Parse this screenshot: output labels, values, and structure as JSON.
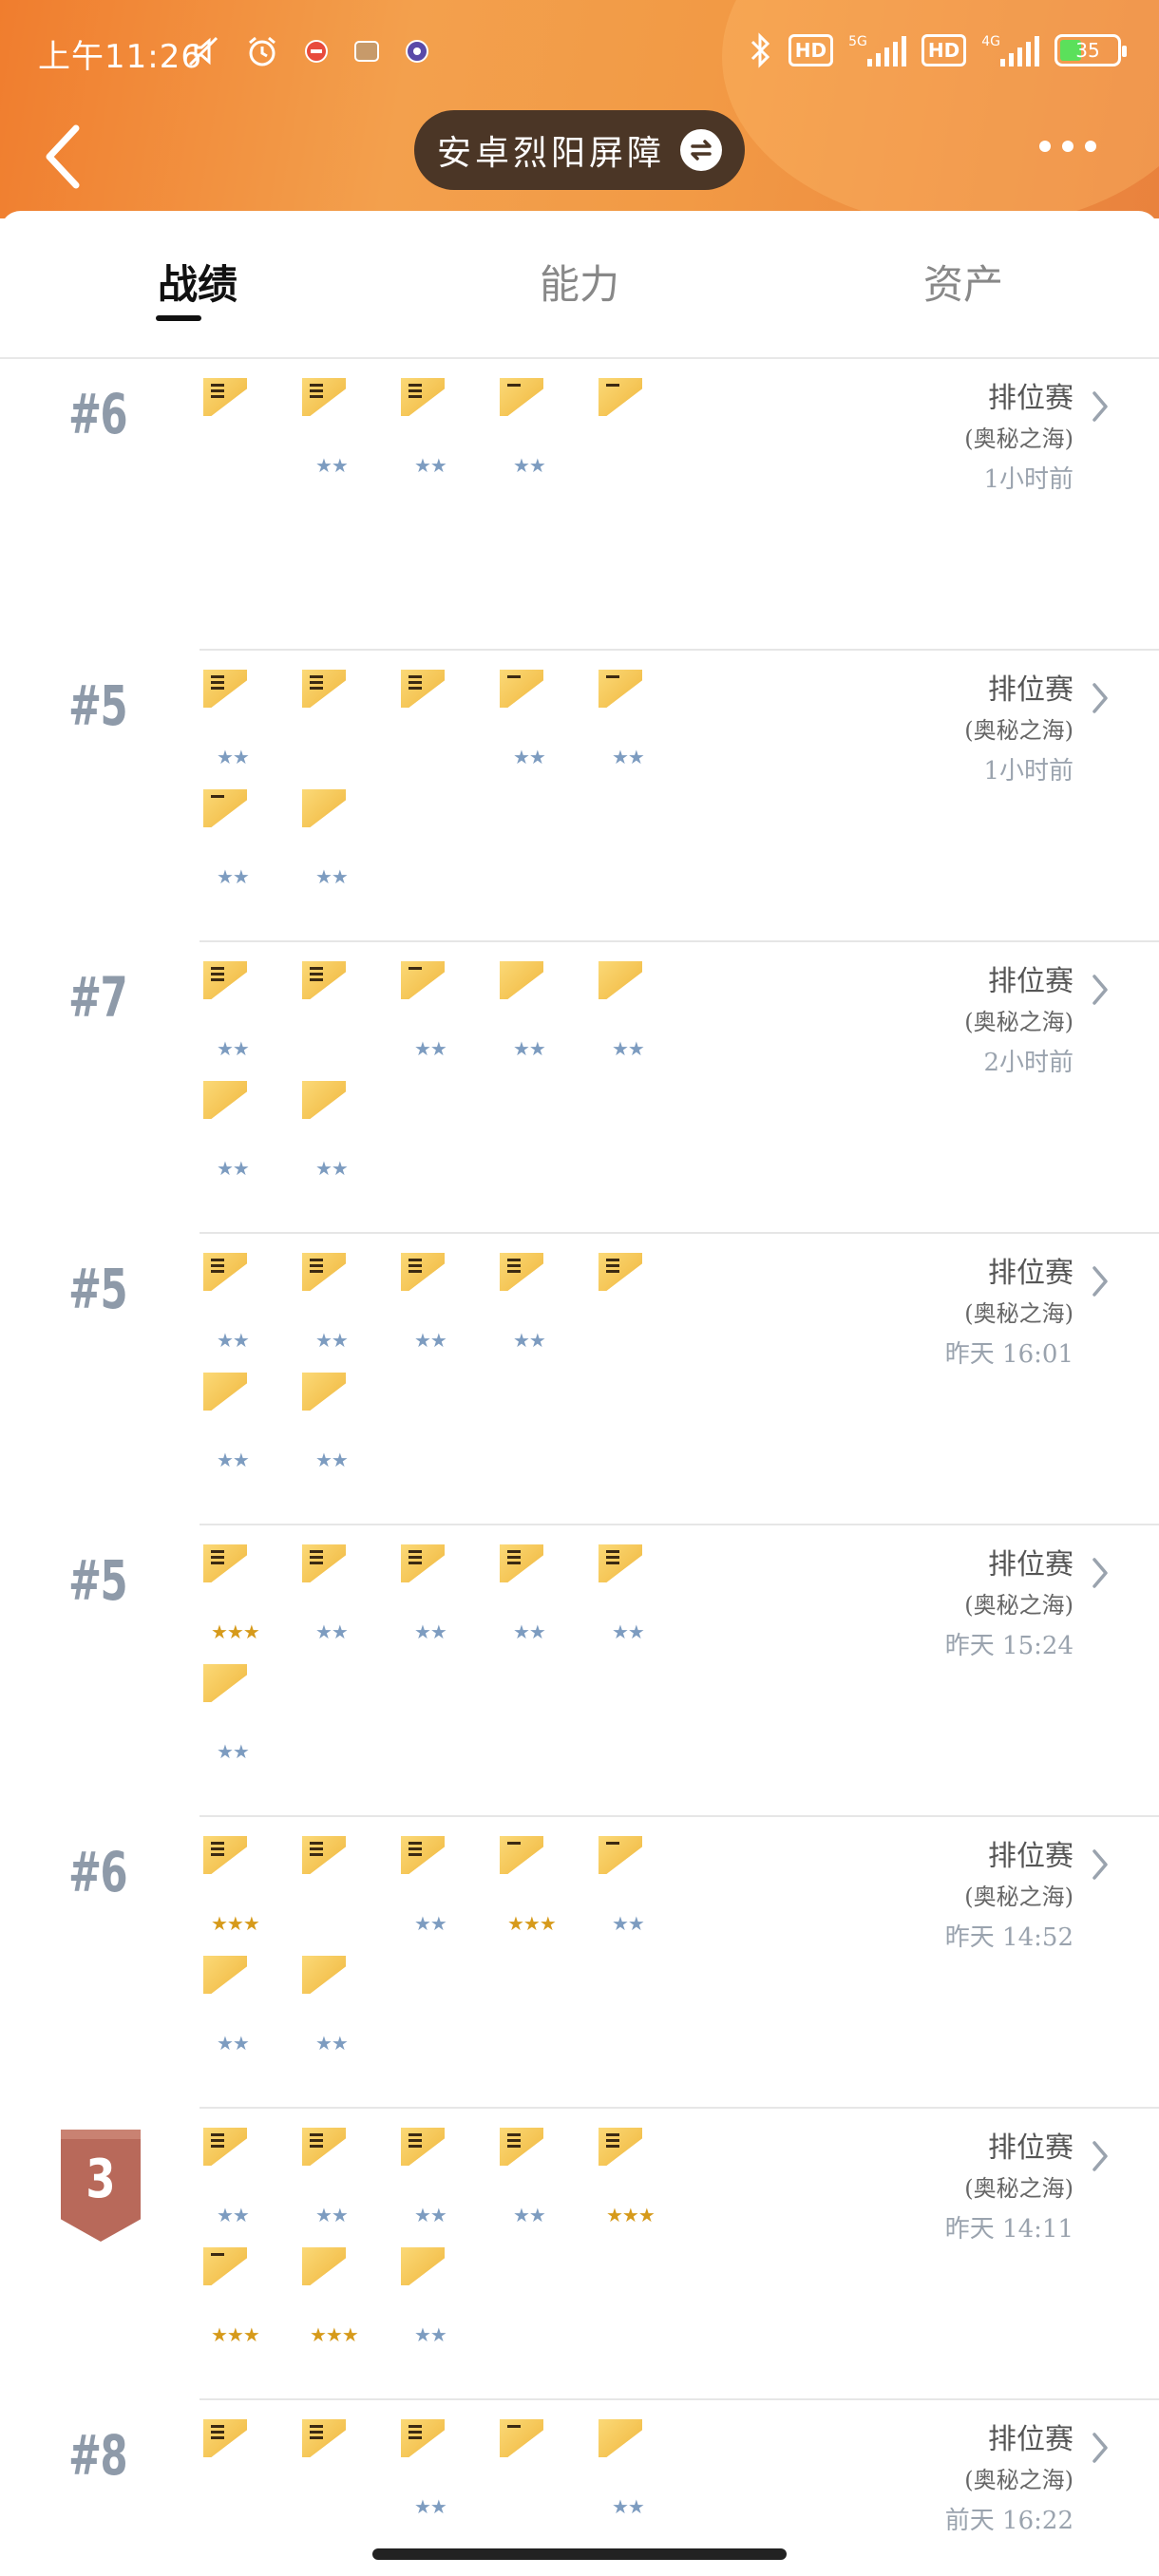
{
  "status_bar": {
    "time": "上午11:26",
    "left_icons": [
      "mute-icon",
      "alarm-icon",
      "app-notification-icon",
      "app-notification-icon",
      "app-notification-icon"
    ],
    "right_icons": [
      "bluetooth-icon",
      "hd-badge",
      "signal-5g-icon",
      "hd-badge",
      "signal-4g-icon"
    ],
    "hd_label": "HD",
    "net_5g": "5G",
    "net_4g": "4G",
    "battery": "35"
  },
  "nav": {
    "title": "安卓烈阳屏障",
    "back_icon": "chevron-left-icon",
    "switch_icon": "swap-icon",
    "more_icon": "more-dots-icon"
  },
  "tabs": [
    {
      "label": "战绩",
      "active": true
    },
    {
      "label": "能力",
      "active": false
    },
    {
      "label": "资产",
      "active": false
    }
  ],
  "colors": {
    "header_orange": "#f29a45",
    "pill_brown": "#4b3626",
    "card_yellow": "#f8c95a",
    "star_blue": "#7d9cc0",
    "star_gold": "#d69a1b",
    "medal_bronze": "#b8695a",
    "rank_gray": "#8e9aa9"
  },
  "matches": [
    {
      "rank": "#6",
      "medal": false,
      "mode": "排位赛",
      "mode_sub": "(奥秘之海)",
      "time": "1小时前",
      "heroes": [
        {
          "lines": 3,
          "stars": 0,
          "star_color": "blue"
        },
        {
          "lines": 3,
          "stars": 2,
          "star_color": "blue"
        },
        {
          "lines": 3,
          "stars": 2,
          "star_color": "blue"
        },
        {
          "lines": 1,
          "stars": 2,
          "star_color": "blue"
        },
        {
          "lines": 1,
          "stars": 0,
          "star_color": "blue"
        }
      ]
    },
    {
      "rank": "#5",
      "medal": false,
      "mode": "排位赛",
      "mode_sub": "(奥秘之海)",
      "time": "1小时前",
      "heroes": [
        {
          "lines": 3,
          "stars": 2,
          "star_color": "blue"
        },
        {
          "lines": 3,
          "stars": 0,
          "star_color": "blue"
        },
        {
          "lines": 3,
          "stars": 0,
          "star_color": "blue"
        },
        {
          "lines": 1,
          "stars": 2,
          "star_color": "blue"
        },
        {
          "lines": 1,
          "stars": 2,
          "star_color": "blue"
        },
        {
          "lines": 1,
          "stars": 2,
          "star_color": "blue"
        },
        {
          "lines": 0,
          "stars": 2,
          "star_color": "blue"
        }
      ]
    },
    {
      "rank": "#7",
      "medal": false,
      "mode": "排位赛",
      "mode_sub": "(奥秘之海)",
      "time": "2小时前",
      "heroes": [
        {
          "lines": 3,
          "stars": 2,
          "star_color": "blue"
        },
        {
          "lines": 3,
          "stars": 0,
          "star_color": "blue"
        },
        {
          "lines": 1,
          "stars": 2,
          "star_color": "blue"
        },
        {
          "lines": 0,
          "stars": 2,
          "star_color": "blue"
        },
        {
          "lines": 0,
          "stars": 2,
          "star_color": "blue"
        },
        {
          "lines": 0,
          "stars": 2,
          "star_color": "blue"
        },
        {
          "lines": 0,
          "stars": 2,
          "star_color": "blue"
        }
      ]
    },
    {
      "rank": "#5",
      "medal": false,
      "mode": "排位赛",
      "mode_sub": "(奥秘之海)",
      "time": "昨天 16:01",
      "heroes": [
        {
          "lines": 3,
          "stars": 2,
          "star_color": "blue"
        },
        {
          "lines": 3,
          "stars": 2,
          "star_color": "blue"
        },
        {
          "lines": 3,
          "stars": 2,
          "star_color": "blue"
        },
        {
          "lines": 3,
          "stars": 2,
          "star_color": "blue"
        },
        {
          "lines": 3,
          "stars": 0,
          "star_color": "blue"
        },
        {
          "lines": 0,
          "stars": 2,
          "star_color": "blue"
        },
        {
          "lines": 0,
          "stars": 2,
          "star_color": "blue"
        }
      ]
    },
    {
      "rank": "#5",
      "medal": false,
      "mode": "排位赛",
      "mode_sub": "(奥秘之海)",
      "time": "昨天 15:24",
      "heroes": [
        {
          "lines": 3,
          "stars": 3,
          "star_color": "gold"
        },
        {
          "lines": 3,
          "stars": 2,
          "star_color": "blue"
        },
        {
          "lines": 3,
          "stars": 2,
          "star_color": "blue"
        },
        {
          "lines": 3,
          "stars": 2,
          "star_color": "blue"
        },
        {
          "lines": 3,
          "stars": 2,
          "star_color": "blue"
        },
        {
          "lines": 0,
          "stars": 2,
          "star_color": "blue"
        }
      ]
    },
    {
      "rank": "#6",
      "medal": false,
      "mode": "排位赛",
      "mode_sub": "(奥秘之海)",
      "time": "昨天 14:52",
      "heroes": [
        {
          "lines": 3,
          "stars": 3,
          "star_color": "gold"
        },
        {
          "lines": 3,
          "stars": 0,
          "star_color": "blue"
        },
        {
          "lines": 3,
          "stars": 2,
          "star_color": "blue"
        },
        {
          "lines": 1,
          "stars": 3,
          "star_color": "gold"
        },
        {
          "lines": 1,
          "stars": 2,
          "star_color": "blue"
        },
        {
          "lines": 0,
          "stars": 2,
          "star_color": "blue"
        },
        {
          "lines": 0,
          "stars": 2,
          "star_color": "blue"
        }
      ]
    },
    {
      "rank": "3",
      "medal": true,
      "mode": "排位赛",
      "mode_sub": "(奥秘之海)",
      "time": "昨天 14:11",
      "heroes": [
        {
          "lines": 3,
          "stars": 2,
          "star_color": "blue"
        },
        {
          "lines": 3,
          "stars": 2,
          "star_color": "blue"
        },
        {
          "lines": 3,
          "stars": 2,
          "star_color": "blue"
        },
        {
          "lines": 3,
          "stars": 2,
          "star_color": "blue"
        },
        {
          "lines": 3,
          "stars": 3,
          "star_color": "gold"
        },
        {
          "lines": 1,
          "stars": 3,
          "star_color": "gold"
        },
        {
          "lines": 0,
          "stars": 3,
          "star_color": "gold"
        },
        {
          "lines": 0,
          "stars": 2,
          "star_color": "blue"
        }
      ]
    },
    {
      "rank": "#8",
      "medal": false,
      "mode": "排位赛",
      "mode_sub": "(奥秘之海)",
      "time": "前天 16:22",
      "heroes": [
        {
          "lines": 3,
          "stars": 0,
          "star_color": "blue"
        },
        {
          "lines": 3,
          "stars": 0,
          "star_color": "blue"
        },
        {
          "lines": 3,
          "stars": 2,
          "star_color": "blue"
        },
        {
          "lines": 1,
          "stars": 0,
          "star_color": "blue"
        },
        {
          "lines": 0,
          "stars": 2,
          "star_color": "blue"
        }
      ]
    }
  ]
}
